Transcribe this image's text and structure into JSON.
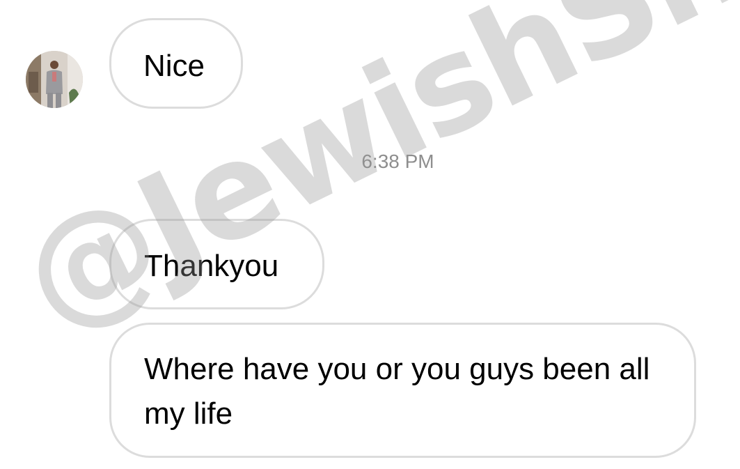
{
  "messages": [
    {
      "text": "Nice"
    },
    {
      "text": "Thankyou"
    },
    {
      "text": "Where have you or you guys been all my life"
    }
  ],
  "timestamp": "6:38 PM",
  "avatar": {
    "icon": "profile-photo"
  },
  "watermark": "@JewishSharp",
  "colors": {
    "bubble_border": "#dcdcdc",
    "timestamp": "#8e8e8e",
    "background": "#ffffff"
  }
}
